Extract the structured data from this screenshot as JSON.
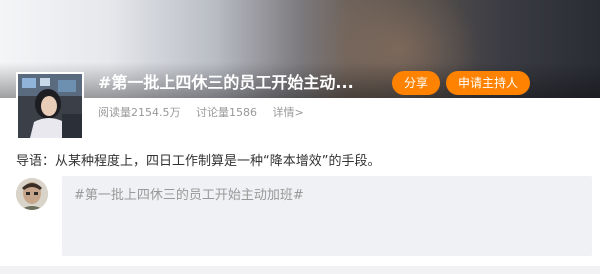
{
  "topic": {
    "title": "#第一批上四休三的员工开始主动...",
    "share_label": "分享",
    "host_label": "申请主持人",
    "reads": "阅读量2154.5万",
    "discussions": "讨论量1586",
    "details_link": "详情>"
  },
  "intro": {
    "text": "导语：从某种程度上，四日工作制算是一种“降本增效”的手段。"
  },
  "composer": {
    "value": "#第一批上四休三的员工开始主动加班#"
  },
  "colors": {
    "accent": "#ff8200",
    "muted_text": "#999999",
    "body_text": "#333333",
    "input_bg": "#f0f1f4"
  }
}
